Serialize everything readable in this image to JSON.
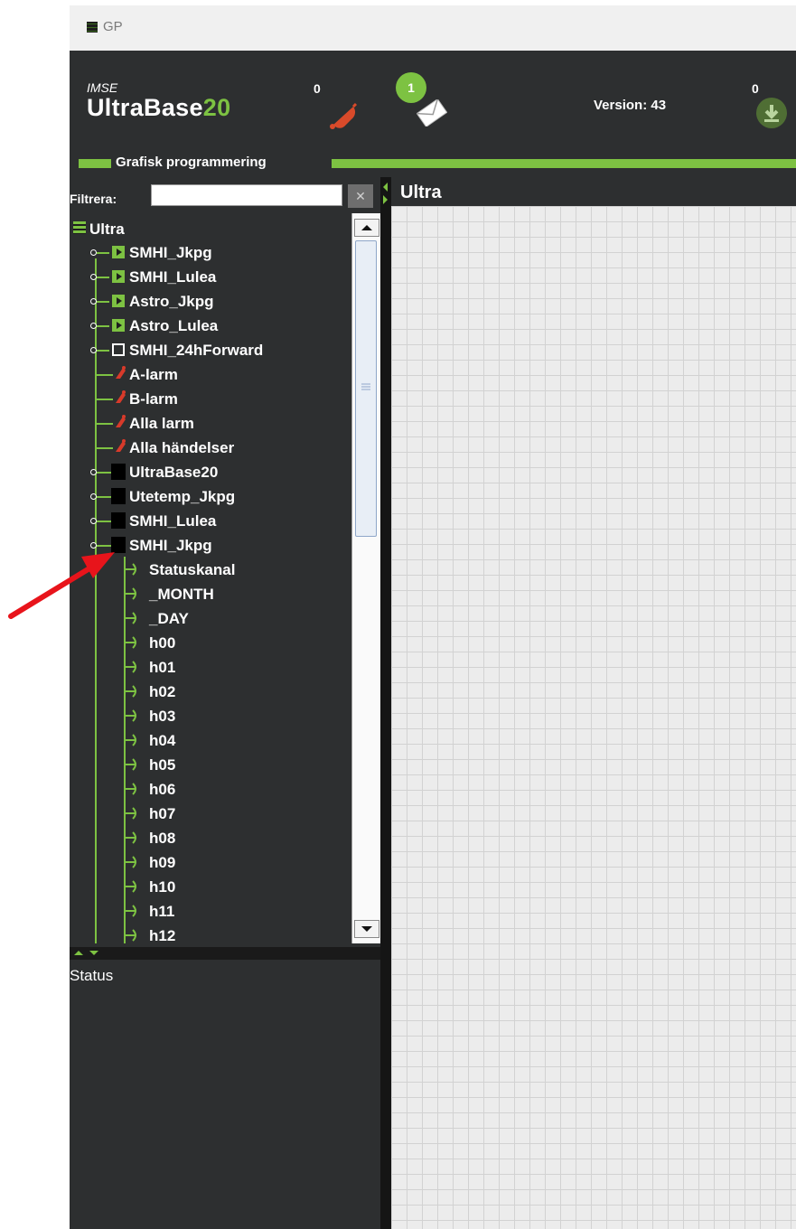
{
  "window": {
    "title": "GP"
  },
  "header": {
    "brand_small": "IMSE",
    "brand_main": "UltraBase",
    "brand_num": "20",
    "alarm_count": "0",
    "message_badge": "1",
    "version": "Version: 43",
    "download_count": "0"
  },
  "section": {
    "title": "Grafisk programmering"
  },
  "filter": {
    "label": "Filtrera:",
    "value": "",
    "clear_glyph": "✕"
  },
  "tree": {
    "root": "Ultra",
    "items": [
      {
        "label": "SMHI_Jkpg",
        "icon": "play-icon"
      },
      {
        "label": "SMHI_Lulea",
        "icon": "play-icon"
      },
      {
        "label": "Astro_Jkpg",
        "icon": "play-icon"
      },
      {
        "label": "Astro_Lulea",
        "icon": "play-icon"
      },
      {
        "label": "SMHI_24hForward",
        "icon": "stop-icon"
      },
      {
        "label": "A-larm",
        "icon": "alarm-icon"
      },
      {
        "label": "B-larm",
        "icon": "alarm-icon"
      },
      {
        "label": "Alla larm",
        "icon": "alarm-icon"
      },
      {
        "label": "Alla händelser",
        "icon": "alarm-icon"
      },
      {
        "label": "UltraBase20",
        "icon": "block-icon"
      },
      {
        "label": "Utetemp_Jkpg",
        "icon": "block-icon"
      },
      {
        "label": "SMHI_Lulea",
        "icon": "block-icon"
      },
      {
        "label": "SMHI_Jkpg",
        "icon": "block-icon"
      }
    ],
    "children": [
      "Statuskanal",
      "_MONTH",
      "_DAY",
      "h00",
      "h01",
      "h02",
      "h03",
      "h04",
      "h05",
      "h06",
      "h07",
      "h08",
      "h09",
      "h10",
      "h11",
      "h12"
    ]
  },
  "status": {
    "label": "Status"
  },
  "canvas": {
    "title": "Ultra"
  },
  "colors": {
    "accent": "#7dc242",
    "panel": "#2d2f30",
    "arrow": "#e8141b"
  }
}
